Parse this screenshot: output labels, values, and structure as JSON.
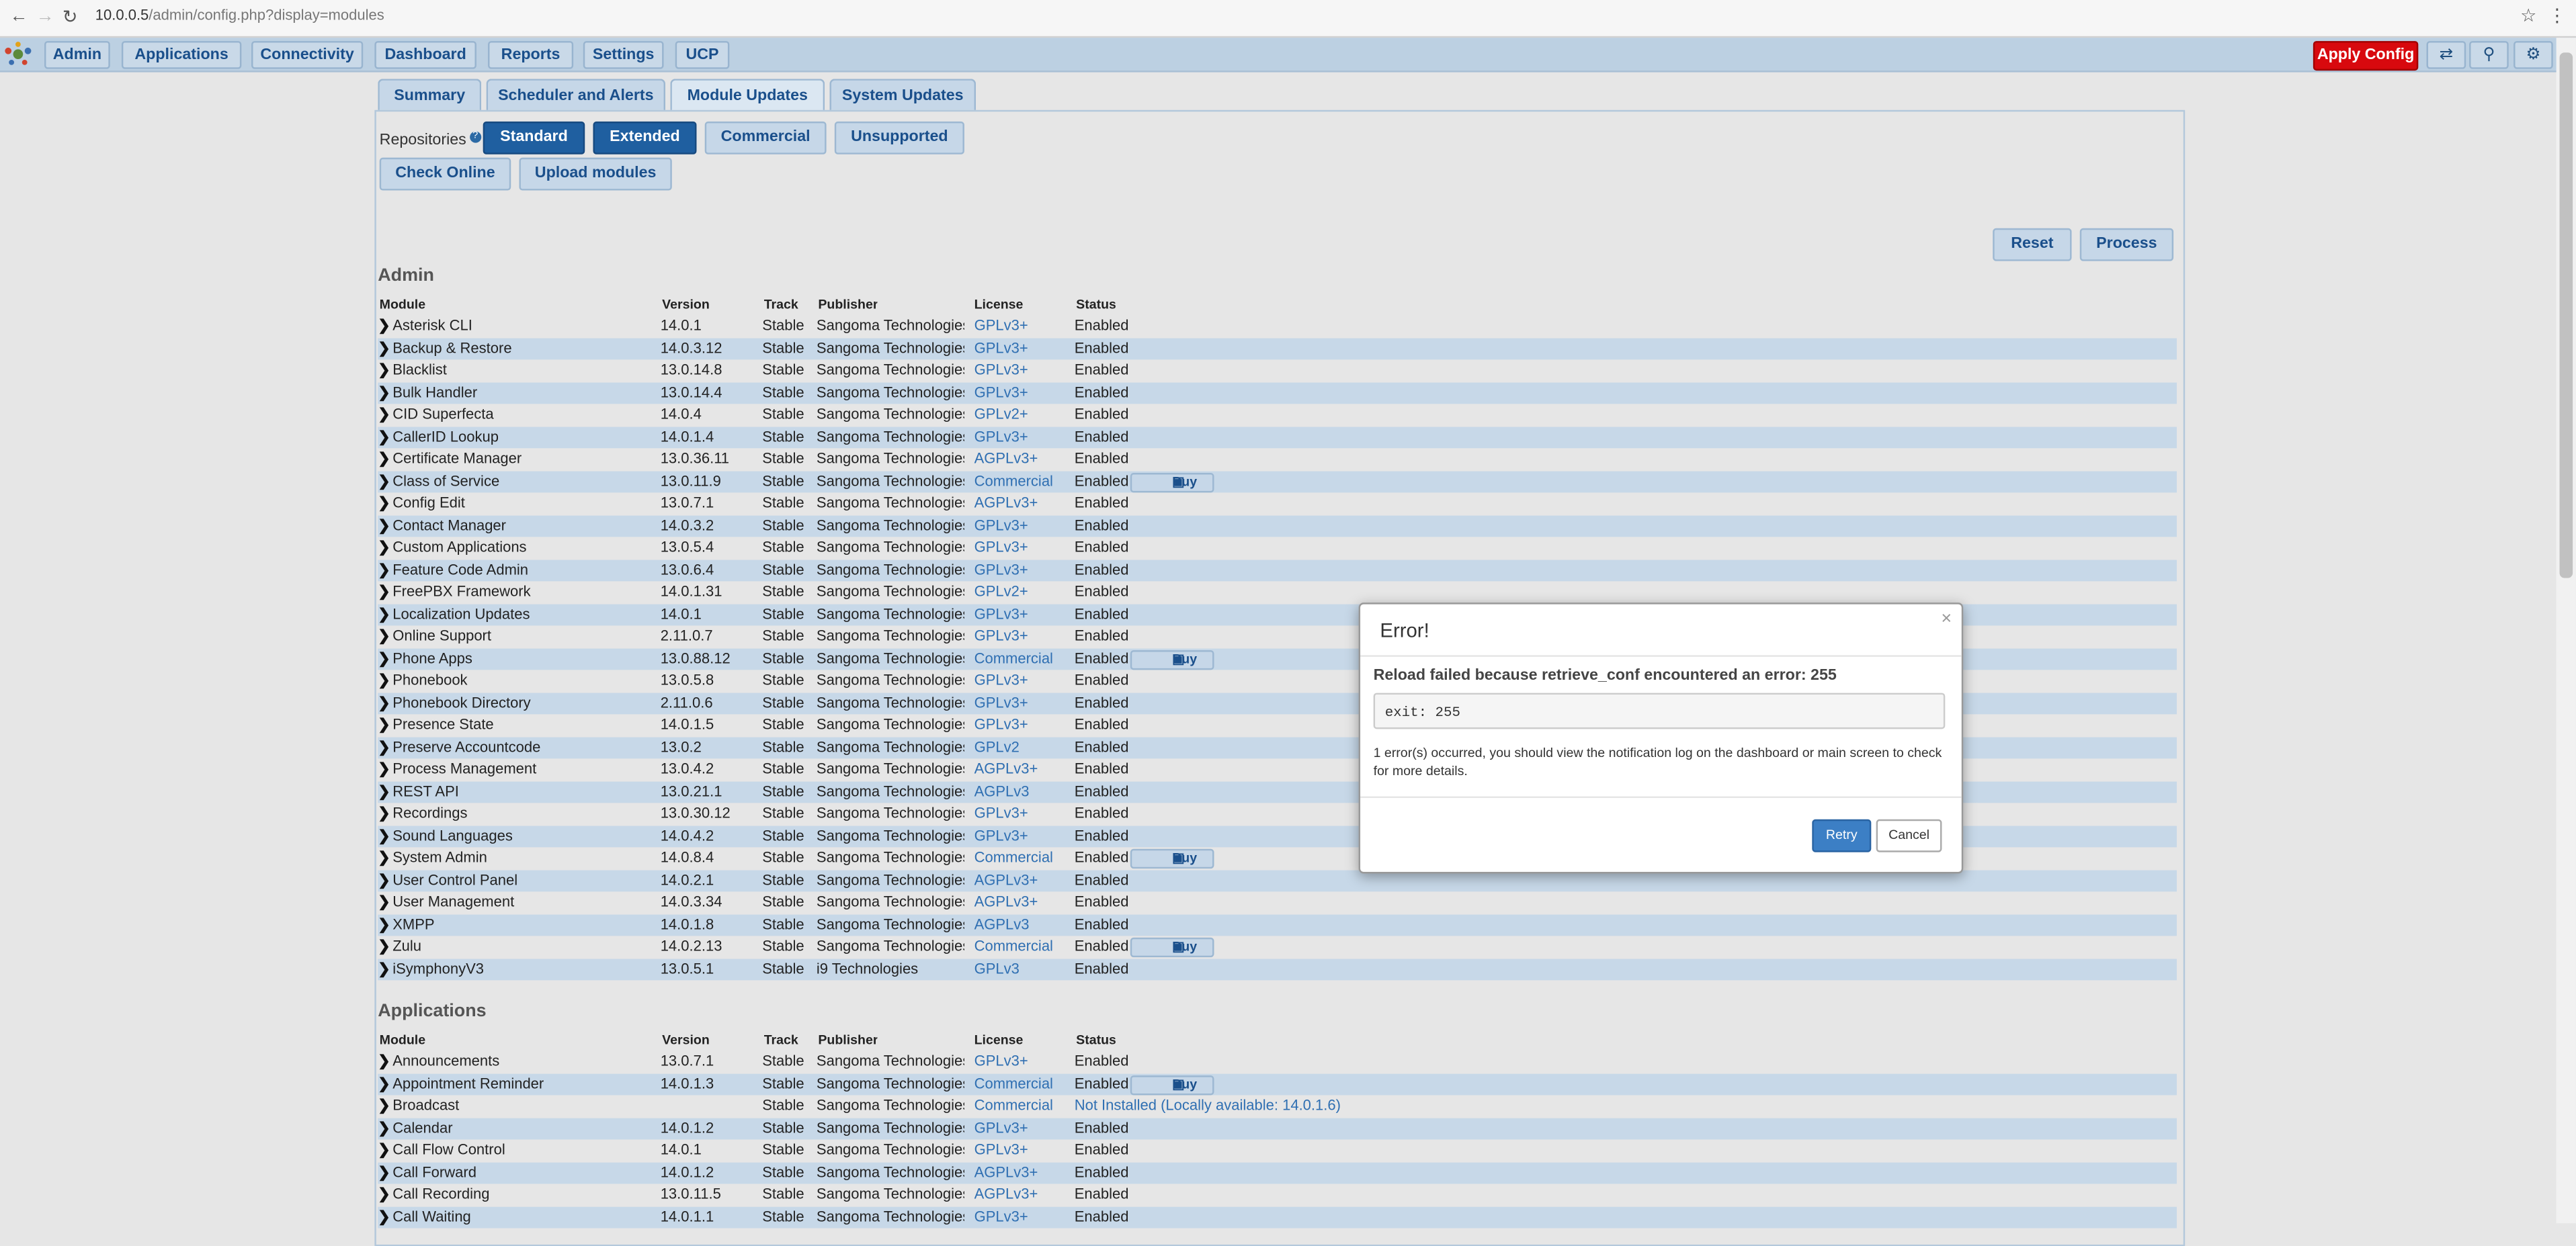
{
  "browser": {
    "url_host": "10.0.0.5",
    "url_path": "/admin/config.php?display=modules",
    "back": "←",
    "forward": "→",
    "reload": "↻",
    "star": "☆",
    "menu": "⋮"
  },
  "nav": {
    "items": [
      "Admin",
      "Applications",
      "Connectivity",
      "Dashboard",
      "Reports",
      "Settings",
      "UCP"
    ],
    "apply_config": "Apply Config",
    "icons": {
      "lang": "⇄",
      "search": "⚲",
      "gear": "⚙"
    }
  },
  "tabs": [
    "Summary",
    "Scheduler and Alerts",
    "Module Updates",
    "System Updates"
  ],
  "repositories": {
    "label": "Repositories",
    "help": "?",
    "buttons": [
      "Standard",
      "Extended",
      "Commercial",
      "Unsupported"
    ]
  },
  "actions": {
    "check_online": "Check Online",
    "upload_modules": "Upload modules",
    "reset": "Reset",
    "process": "Process"
  },
  "columns": [
    "Module",
    "Version",
    "Track",
    "Publisher",
    "License",
    "Status"
  ],
  "chevron": "❯",
  "buy_label": "Buy",
  "buy_icon": "▣",
  "admin": {
    "title": "Admin",
    "rows": [
      {
        "m": "Asterisk CLI",
        "v": "14.0.1",
        "t": "Stable",
        "p": "Sangoma Technologies",
        "l": "GPLv3+",
        "s": "Enabled"
      },
      {
        "m": "Backup & Restore",
        "v": "14.0.3.12",
        "t": "Stable",
        "p": "Sangoma Technologies",
        "l": "GPLv3+",
        "s": "Enabled"
      },
      {
        "m": "Blacklist",
        "v": "13.0.14.8",
        "t": "Stable",
        "p": "Sangoma Technologies",
        "l": "GPLv3+",
        "s": "Enabled"
      },
      {
        "m": "Bulk Handler",
        "v": "13.0.14.4",
        "t": "Stable",
        "p": "Sangoma Technologies",
        "l": "GPLv3+",
        "s": "Enabled"
      },
      {
        "m": "CID Superfecta",
        "v": "14.0.4",
        "t": "Stable",
        "p": "Sangoma Technologies",
        "l": "GPLv2+",
        "s": "Enabled"
      },
      {
        "m": "CallerID Lookup",
        "v": "14.0.1.4",
        "t": "Stable",
        "p": "Sangoma Technologies",
        "l": "GPLv3+",
        "s": "Enabled"
      },
      {
        "m": "Certificate Manager",
        "v": "13.0.36.11",
        "t": "Stable",
        "p": "Sangoma Technologies",
        "l": "AGPLv3+",
        "s": "Enabled"
      },
      {
        "m": "Class of Service",
        "v": "13.0.11.9",
        "t": "Stable",
        "p": "Sangoma Technologies",
        "l": "Commercial",
        "s": "Enabled",
        "buy": true
      },
      {
        "m": "Config Edit",
        "v": "13.0.7.1",
        "t": "Stable",
        "p": "Sangoma Technologies",
        "l": "AGPLv3+",
        "s": "Enabled"
      },
      {
        "m": "Contact Manager",
        "v": "14.0.3.2",
        "t": "Stable",
        "p": "Sangoma Technologies",
        "l": "GPLv3+",
        "s": "Enabled"
      },
      {
        "m": "Custom Applications",
        "v": "13.0.5.4",
        "t": "Stable",
        "p": "Sangoma Technologies",
        "l": "GPLv3+",
        "s": "Enabled"
      },
      {
        "m": "Feature Code Admin",
        "v": "13.0.6.4",
        "t": "Stable",
        "p": "Sangoma Technologies",
        "l": "GPLv3+",
        "s": "Enabled"
      },
      {
        "m": "FreePBX Framework",
        "v": "14.0.1.31",
        "t": "Stable",
        "p": "Sangoma Technologies",
        "l": "GPLv2+",
        "s": "Enabled"
      },
      {
        "m": "Localization Updates",
        "v": "14.0.1",
        "t": "Stable",
        "p": "Sangoma Technologies",
        "l": "GPLv3+",
        "s": "Enabled"
      },
      {
        "m": "Online Support",
        "v": "2.11.0.7",
        "t": "Stable",
        "p": "Sangoma Technologies",
        "l": "GPLv3+",
        "s": "Enabled"
      },
      {
        "m": "Phone Apps",
        "v": "13.0.88.12",
        "t": "Stable",
        "p": "Sangoma Technologies",
        "l": "Commercial",
        "s": "Enabled",
        "buy": true
      },
      {
        "m": "Phonebook",
        "v": "13.0.5.8",
        "t": "Stable",
        "p": "Sangoma Technologies",
        "l": "GPLv3+",
        "s": "Enabled"
      },
      {
        "m": "Phonebook Directory",
        "v": "2.11.0.6",
        "t": "Stable",
        "p": "Sangoma Technologies",
        "l": "GPLv3+",
        "s": "Enabled"
      },
      {
        "m": "Presence State",
        "v": "14.0.1.5",
        "t": "Stable",
        "p": "Sangoma Technologies",
        "l": "GPLv3+",
        "s": "Enabled"
      },
      {
        "m": "Preserve Accountcode",
        "v": "13.0.2",
        "t": "Stable",
        "p": "Sangoma Technologies",
        "l": "GPLv2",
        "s": "Enabled"
      },
      {
        "m": "Process Management",
        "v": "13.0.4.2",
        "t": "Stable",
        "p": "Sangoma Technologies",
        "l": "AGPLv3+",
        "s": "Enabled"
      },
      {
        "m": "REST API",
        "v": "13.0.21.1",
        "t": "Stable",
        "p": "Sangoma Technologies",
        "l": "AGPLv3",
        "s": "Enabled"
      },
      {
        "m": "Recordings",
        "v": "13.0.30.12",
        "t": "Stable",
        "p": "Sangoma Technologies",
        "l": "GPLv3+",
        "s": "Enabled"
      },
      {
        "m": "Sound Languages",
        "v": "14.0.4.2",
        "t": "Stable",
        "p": "Sangoma Technologies",
        "l": "GPLv3+",
        "s": "Enabled"
      },
      {
        "m": "System Admin",
        "v": "14.0.8.4",
        "t": "Stable",
        "p": "Sangoma Technologies",
        "l": "Commercial",
        "s": "Enabled",
        "buy": true
      },
      {
        "m": "User Control Panel",
        "v": "14.0.2.1",
        "t": "Stable",
        "p": "Sangoma Technologies",
        "l": "AGPLv3+",
        "s": "Enabled"
      },
      {
        "m": "User Management",
        "v": "14.0.3.34",
        "t": "Stable",
        "p": "Sangoma Technologies",
        "l": "AGPLv3+",
        "s": "Enabled"
      },
      {
        "m": "XMPP",
        "v": "14.0.1.8",
        "t": "Stable",
        "p": "Sangoma Technologies",
        "l": "AGPLv3",
        "s": "Enabled"
      },
      {
        "m": "Zulu",
        "v": "14.0.2.13",
        "t": "Stable",
        "p": "Sangoma Technologies",
        "l": "Commercial",
        "s": "Enabled",
        "buy": true
      },
      {
        "m": "iSymphonyV3",
        "v": "13.0.5.1",
        "t": "Stable",
        "p": "i9 Technologies",
        "l": "GPLv3",
        "s": "Enabled"
      }
    ]
  },
  "applications": {
    "title": "Applications",
    "rows": [
      {
        "m": "Announcements",
        "v": "13.0.7.1",
        "t": "Stable",
        "p": "Sangoma Technologies",
        "l": "GPLv3+",
        "s": "Enabled"
      },
      {
        "m": "Appointment Reminder",
        "v": "14.0.1.3",
        "t": "Stable",
        "p": "Sangoma Technologies",
        "l": "Commercial",
        "s": "Enabled",
        "buy": true
      },
      {
        "m": "Broadcast",
        "v": "",
        "t": "Stable",
        "p": "Sangoma Technologies",
        "l": "Commercial",
        "s": "Not Installed (Locally available: 14.0.1.6)",
        "ni": true
      },
      {
        "m": "Calendar",
        "v": "14.0.1.2",
        "t": "Stable",
        "p": "Sangoma Technologies",
        "l": "GPLv3+",
        "s": "Enabled"
      },
      {
        "m": "Call Flow Control",
        "v": "14.0.1",
        "t": "Stable",
        "p": "Sangoma Technologies",
        "l": "GPLv3+",
        "s": "Enabled"
      },
      {
        "m": "Call Forward",
        "v": "14.0.1.2",
        "t": "Stable",
        "p": "Sangoma Technologies",
        "l": "AGPLv3+",
        "s": "Enabled"
      },
      {
        "m": "Call Recording",
        "v": "13.0.11.5",
        "t": "Stable",
        "p": "Sangoma Technologies",
        "l": "AGPLv3+",
        "s": "Enabled"
      },
      {
        "m": "Call Waiting",
        "v": "14.0.1.1",
        "t": "Stable",
        "p": "Sangoma Technologies",
        "l": "GPLv3+",
        "s": "Enabled"
      }
    ]
  },
  "modal": {
    "title": "Error!",
    "close": "×",
    "message": "Reload failed because retrieve_conf encountered an error: 255",
    "code": "exit: 255",
    "detail": "1 error(s) occurred, you should view the notification log on the dashboard or main screen to check for more details.",
    "retry": "Retry",
    "cancel": "Cancel"
  }
}
